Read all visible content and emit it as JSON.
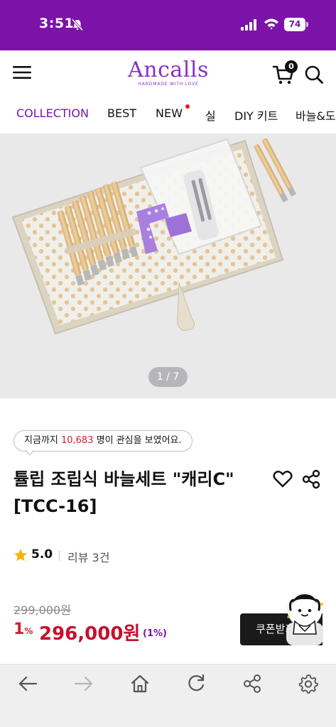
{
  "status_bar": {
    "time": "3:51",
    "battery": "74"
  },
  "header": {
    "logo_text": "Ancalls",
    "logo_tagline": "HANDMADE WITH LOVE",
    "cart_count": "0"
  },
  "nav": {
    "items": [
      {
        "label": "COLLECTION",
        "active": true
      },
      {
        "label": "BEST"
      },
      {
        "label": "NEW",
        "has_dot": true
      },
      {
        "label": "실"
      },
      {
        "label": "DIY 키트"
      },
      {
        "label": "바늘&도구"
      }
    ]
  },
  "gallery": {
    "pager": "1 / 7"
  },
  "product": {
    "interest_prefix": "지금까지 ",
    "interest_count": "10,683",
    "interest_suffix": " 명이 관심을 보였어요.",
    "title": "튤립 조립식 바늘세트 \"캐리C\" [TCC-16]",
    "rating": "5.0",
    "review_label": "리뷰 3건",
    "original_price": "299,000원",
    "discount_rate": "1",
    "discount_unit": "%",
    "sale_price": "296,000원",
    "sale_percent": "(1%)",
    "coupon_label": "쿠폰받기"
  },
  "colors": {
    "brand": "#7c13a8",
    "price_red": "#c8102e",
    "accent_red": "#d81e2c"
  }
}
